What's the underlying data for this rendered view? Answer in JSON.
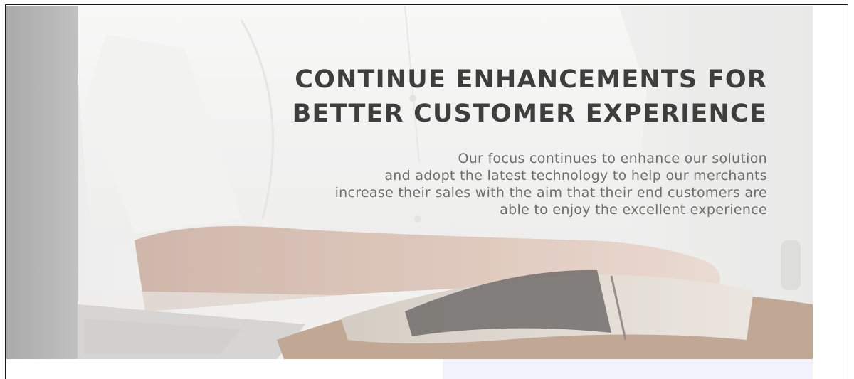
{
  "hero": {
    "image_icon": "office-desk-photo",
    "headline_lines": [
      "CONTINUE ENHANCEMENTS FOR",
      "BETTER CUSTOMER EXPERIENCE"
    ],
    "body_lines": [
      "Our focus continues to enhance our solution",
      "and adopt the latest technology to help our merchants",
      "increase their sales with the aim that their end customers are",
      "able to enjoy the excellent experience"
    ]
  },
  "colors": {
    "headline": "#3e3e3e",
    "body_text": "#6d6d6d",
    "strip": "#f1f3fc"
  }
}
